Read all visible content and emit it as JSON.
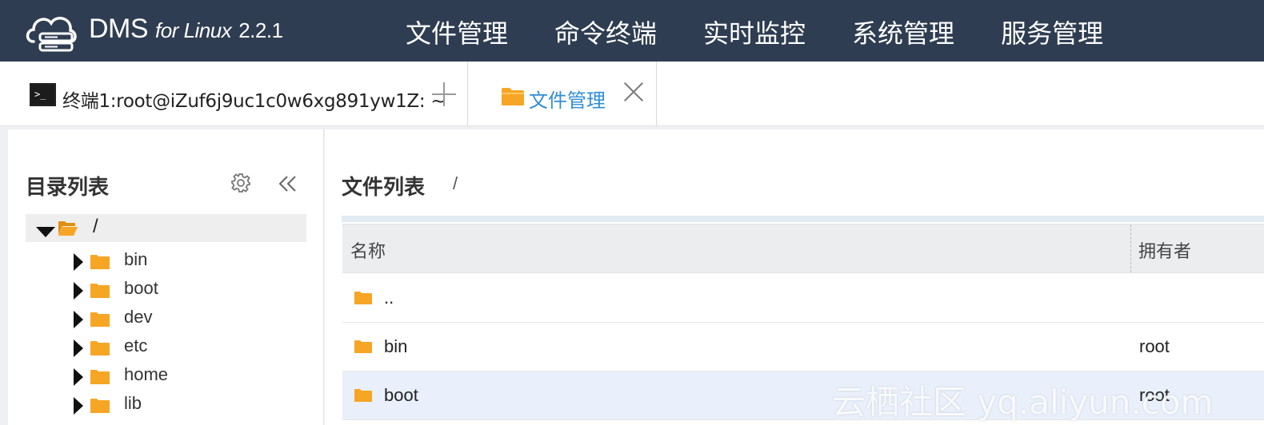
{
  "app": {
    "brand_name": "DMS",
    "brand_for": "for Linux",
    "brand_version": "2.2.1"
  },
  "nav": {
    "items": [
      "文件管理",
      "命令终端",
      "实时监控",
      "系统管理",
      "服务管理"
    ]
  },
  "tabs": {
    "terminal_label": "终端1:root@iZuf6j9uc1c0w6xg891yw1Z: ~",
    "file_label": "文件管理"
  },
  "directory": {
    "title": "目录列表",
    "root": "/",
    "items": [
      "bin",
      "boot",
      "dev",
      "etc",
      "home",
      "lib"
    ]
  },
  "files": {
    "title": "文件列表",
    "path": "/",
    "columns": {
      "name": "名称",
      "owner": "拥有者"
    },
    "rows": [
      {
        "name": "..",
        "owner": ""
      },
      {
        "name": "bin",
        "owner": "root"
      },
      {
        "name": "boot",
        "owner": "root"
      }
    ]
  },
  "watermark": "云栖社区 yq.aliyun.com",
  "colors": {
    "topbar": "#2f3d52",
    "accent": "#2e8ed8",
    "folder": "#f7a524",
    "selected_row": "#e9f0fb"
  }
}
